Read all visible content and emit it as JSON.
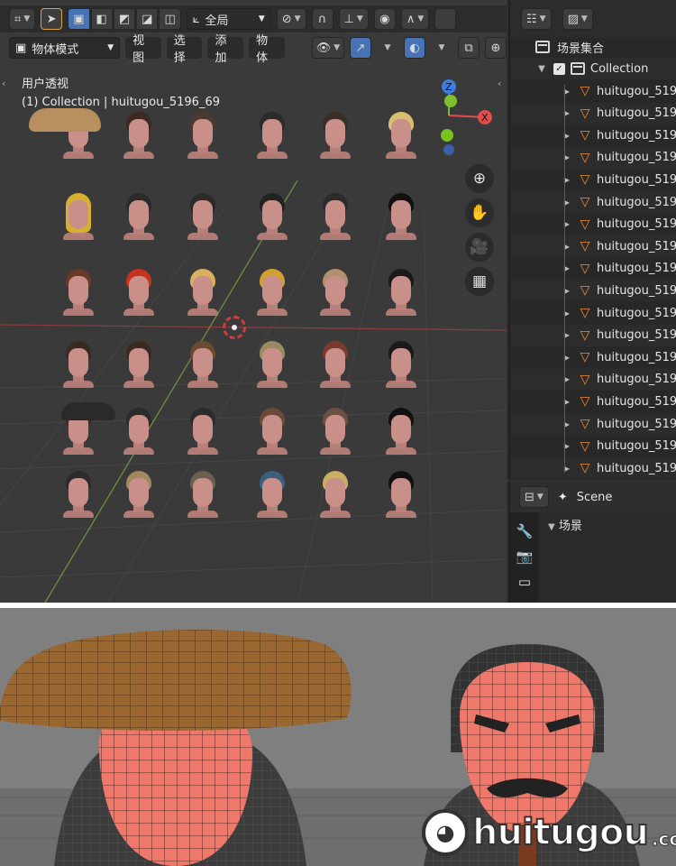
{
  "toolbar_row1": {
    "transform_orientation": "全局"
  },
  "toolbar_row2": {
    "mode": "物体模式",
    "menus": [
      "视图",
      "选择",
      "添加",
      "物体"
    ]
  },
  "viewport": {
    "view_name": "用户透视",
    "collection_info": "(1) Collection | huitugou_5196_69"
  },
  "outliner": {
    "scene_collection": "场景集合",
    "collection": "Collection",
    "objects": [
      "huitugou_519",
      "huitugou_519",
      "huitugou_519",
      "huitugou_519",
      "huitugou_519",
      "huitugou_519",
      "huitugou_519",
      "huitugou_519",
      "huitugou_519",
      "huitugou_519",
      "huitugou_519",
      "huitugou_519",
      "huitugou_519",
      "huitugou_519",
      "huitugou_519",
      "huitugou_519",
      "huitugou_519",
      "huitugou_519"
    ]
  },
  "properties": {
    "scene_label": "Scene",
    "section": "场景"
  },
  "watermark": {
    "text": "huitugou",
    "suffix": ".com"
  },
  "colors": {
    "accent": "#4772b3",
    "object_icon": "#ef8c30",
    "gizmo_x": "#e04d4d",
    "gizmo_y": "#7fbf2a",
    "gizmo_z": "#3d7de0",
    "skin": "#c9908a"
  }
}
